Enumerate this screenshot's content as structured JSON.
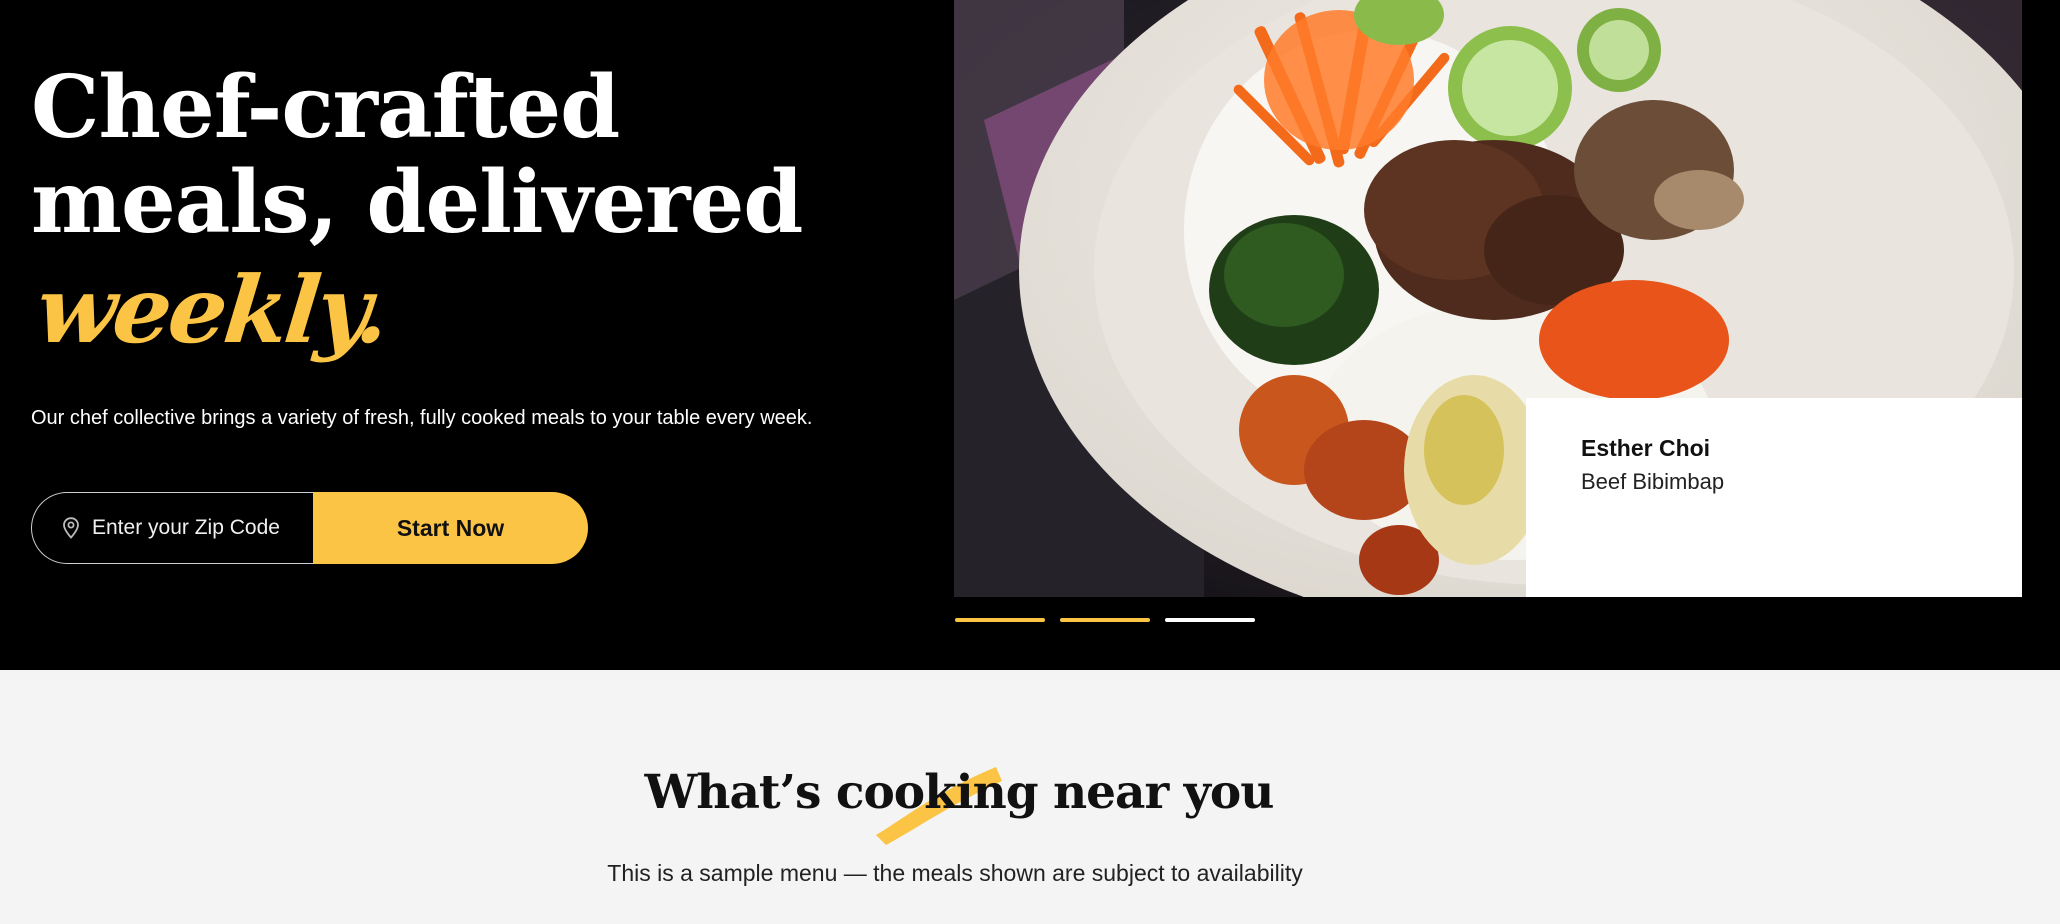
{
  "hero": {
    "headline_line1": "Chef-crafted",
    "headline_line2": "meals, delivered",
    "headline_accent": "weekly",
    "headline_accent_dot": ".",
    "lead": "Our chef collective brings a variety of fresh, fully cooked meals to your table every week.",
    "zip_placeholder": "Enter your Zip Code",
    "start_label": "Start Now",
    "zip_icon": "location-pin-icon"
  },
  "carousel": {
    "chef_name": "Esther Choi",
    "dish_name": "Beef Bibimbap",
    "slides": 3,
    "active_slide": 3
  },
  "menu": {
    "title_before": "What’s ",
    "title_highlight": "cooking",
    "title_after": " near you",
    "subtitle": "This is a sample menu — the meals shown are subject to availability"
  },
  "colors": {
    "accent": "#fcc444",
    "hero_bg": "#000000",
    "section_bg": "#f4f4f4"
  }
}
